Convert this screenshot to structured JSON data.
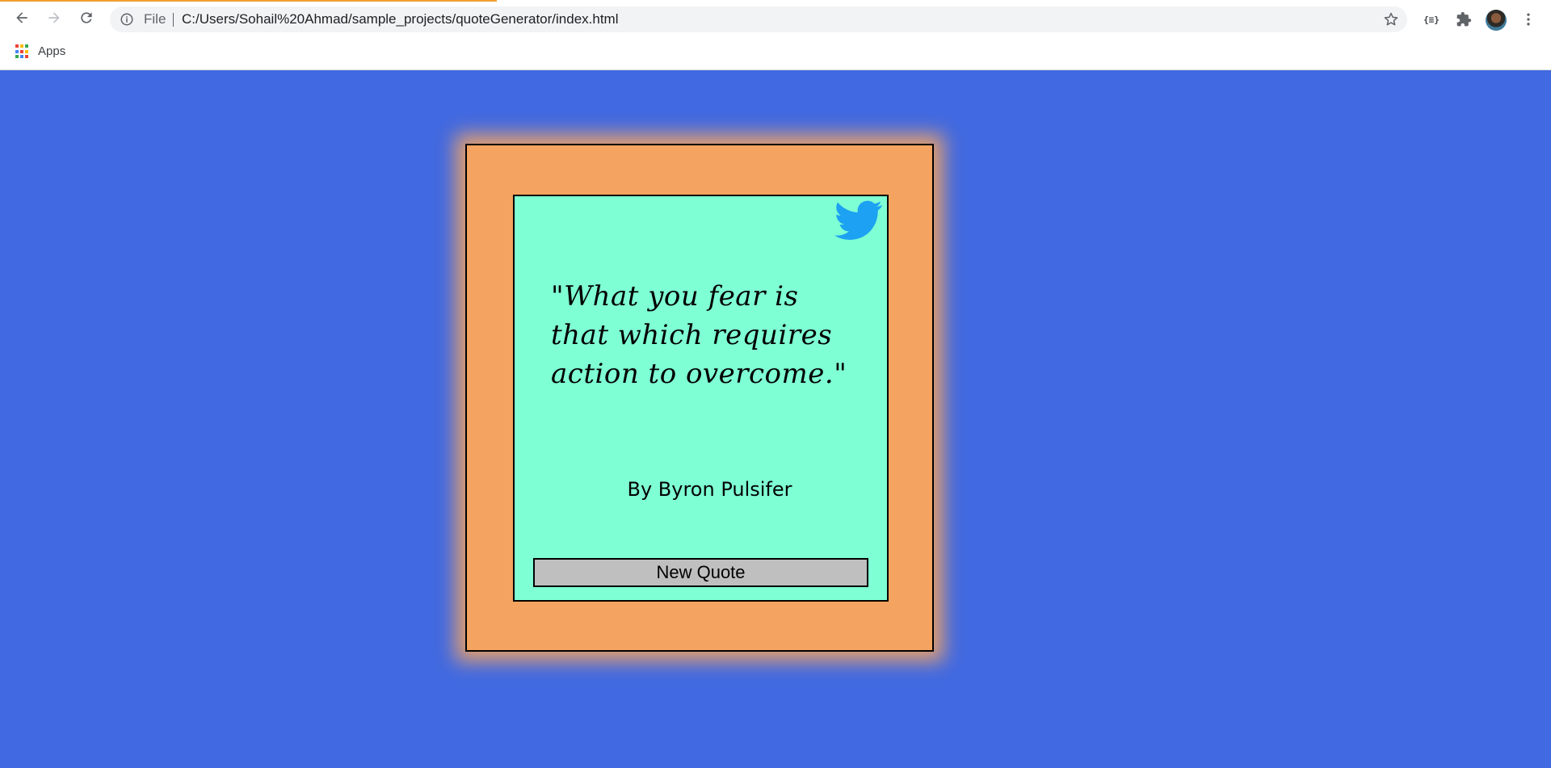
{
  "browser": {
    "scheme_label": "File",
    "url": "C:/Users/Sohail%20Ahmad/sample_projects/quoteGenerator/index.html",
    "extension_label": "{≡}",
    "bookmarks": {
      "apps_label": "Apps"
    }
  },
  "icons": {
    "back": "arrow-left",
    "forward": "arrow-right",
    "reload": "reload",
    "info": "info-circle",
    "star": "star-outline",
    "extensions": "puzzle",
    "menu": "vertical-dots",
    "apps": "grid-9",
    "twitter": "twitter-bird"
  },
  "colors": {
    "page_background": "#4169e1",
    "outer_box": "#f4a460",
    "card": "#7fffd4",
    "button": "#bfbfbf",
    "twitter_blue": "#1da1f2"
  },
  "quote": {
    "text": "\"What you fear is that which requires action to overcome.\"",
    "author": "By Byron Pulsifer",
    "new_quote_label": "New Quote"
  }
}
